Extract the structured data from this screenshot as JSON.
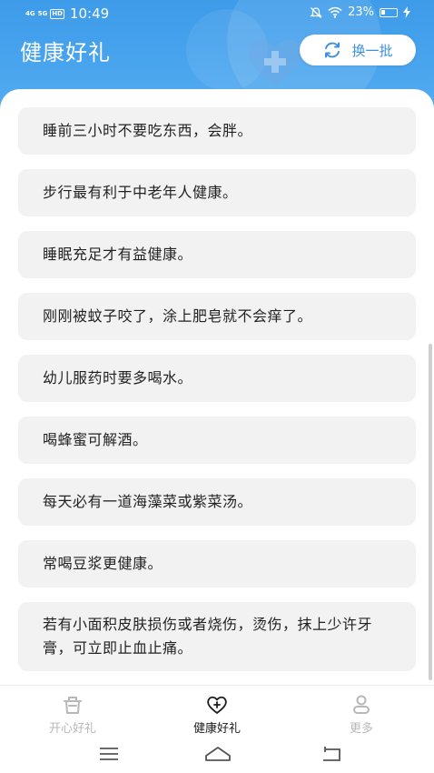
{
  "status_bar": {
    "signal1": "4G",
    "signal2": "5G",
    "hd": "HD",
    "time": "10:49",
    "battery": "23%"
  },
  "header": {
    "title": "健康好礼",
    "refresh_label": "换一批"
  },
  "tips": [
    "睡前三小时不要吃东西，会胖。",
    "步行最有利于中老年人健康。",
    "睡眠充足才有益健康。",
    "刚刚被蚊子咬了，涂上肥皂就不会痒了。",
    "幼儿服药时要多喝水。",
    "喝蜂蜜可解酒。",
    "每天必有一道海藻菜或紫菜汤。",
    "常喝豆浆更健康。",
    "若有小面积皮肤损伤或者烧伤，烫伤，抹上少许牙膏，可立即止血止痛。"
  ],
  "tabs": [
    {
      "label": "开心好礼",
      "icon": "gift-basket-icon",
      "active": false
    },
    {
      "label": "健康好礼",
      "icon": "heart-plus-icon",
      "active": true
    },
    {
      "label": "更多",
      "icon": "person-icon",
      "active": false
    }
  ],
  "colors": {
    "header_blue": "#3d9be9",
    "accent": "#3d8fe0",
    "card_bg": "#f2f2f2",
    "tab_inactive": "#b8b8b8",
    "tab_active": "#1b1b1b"
  }
}
